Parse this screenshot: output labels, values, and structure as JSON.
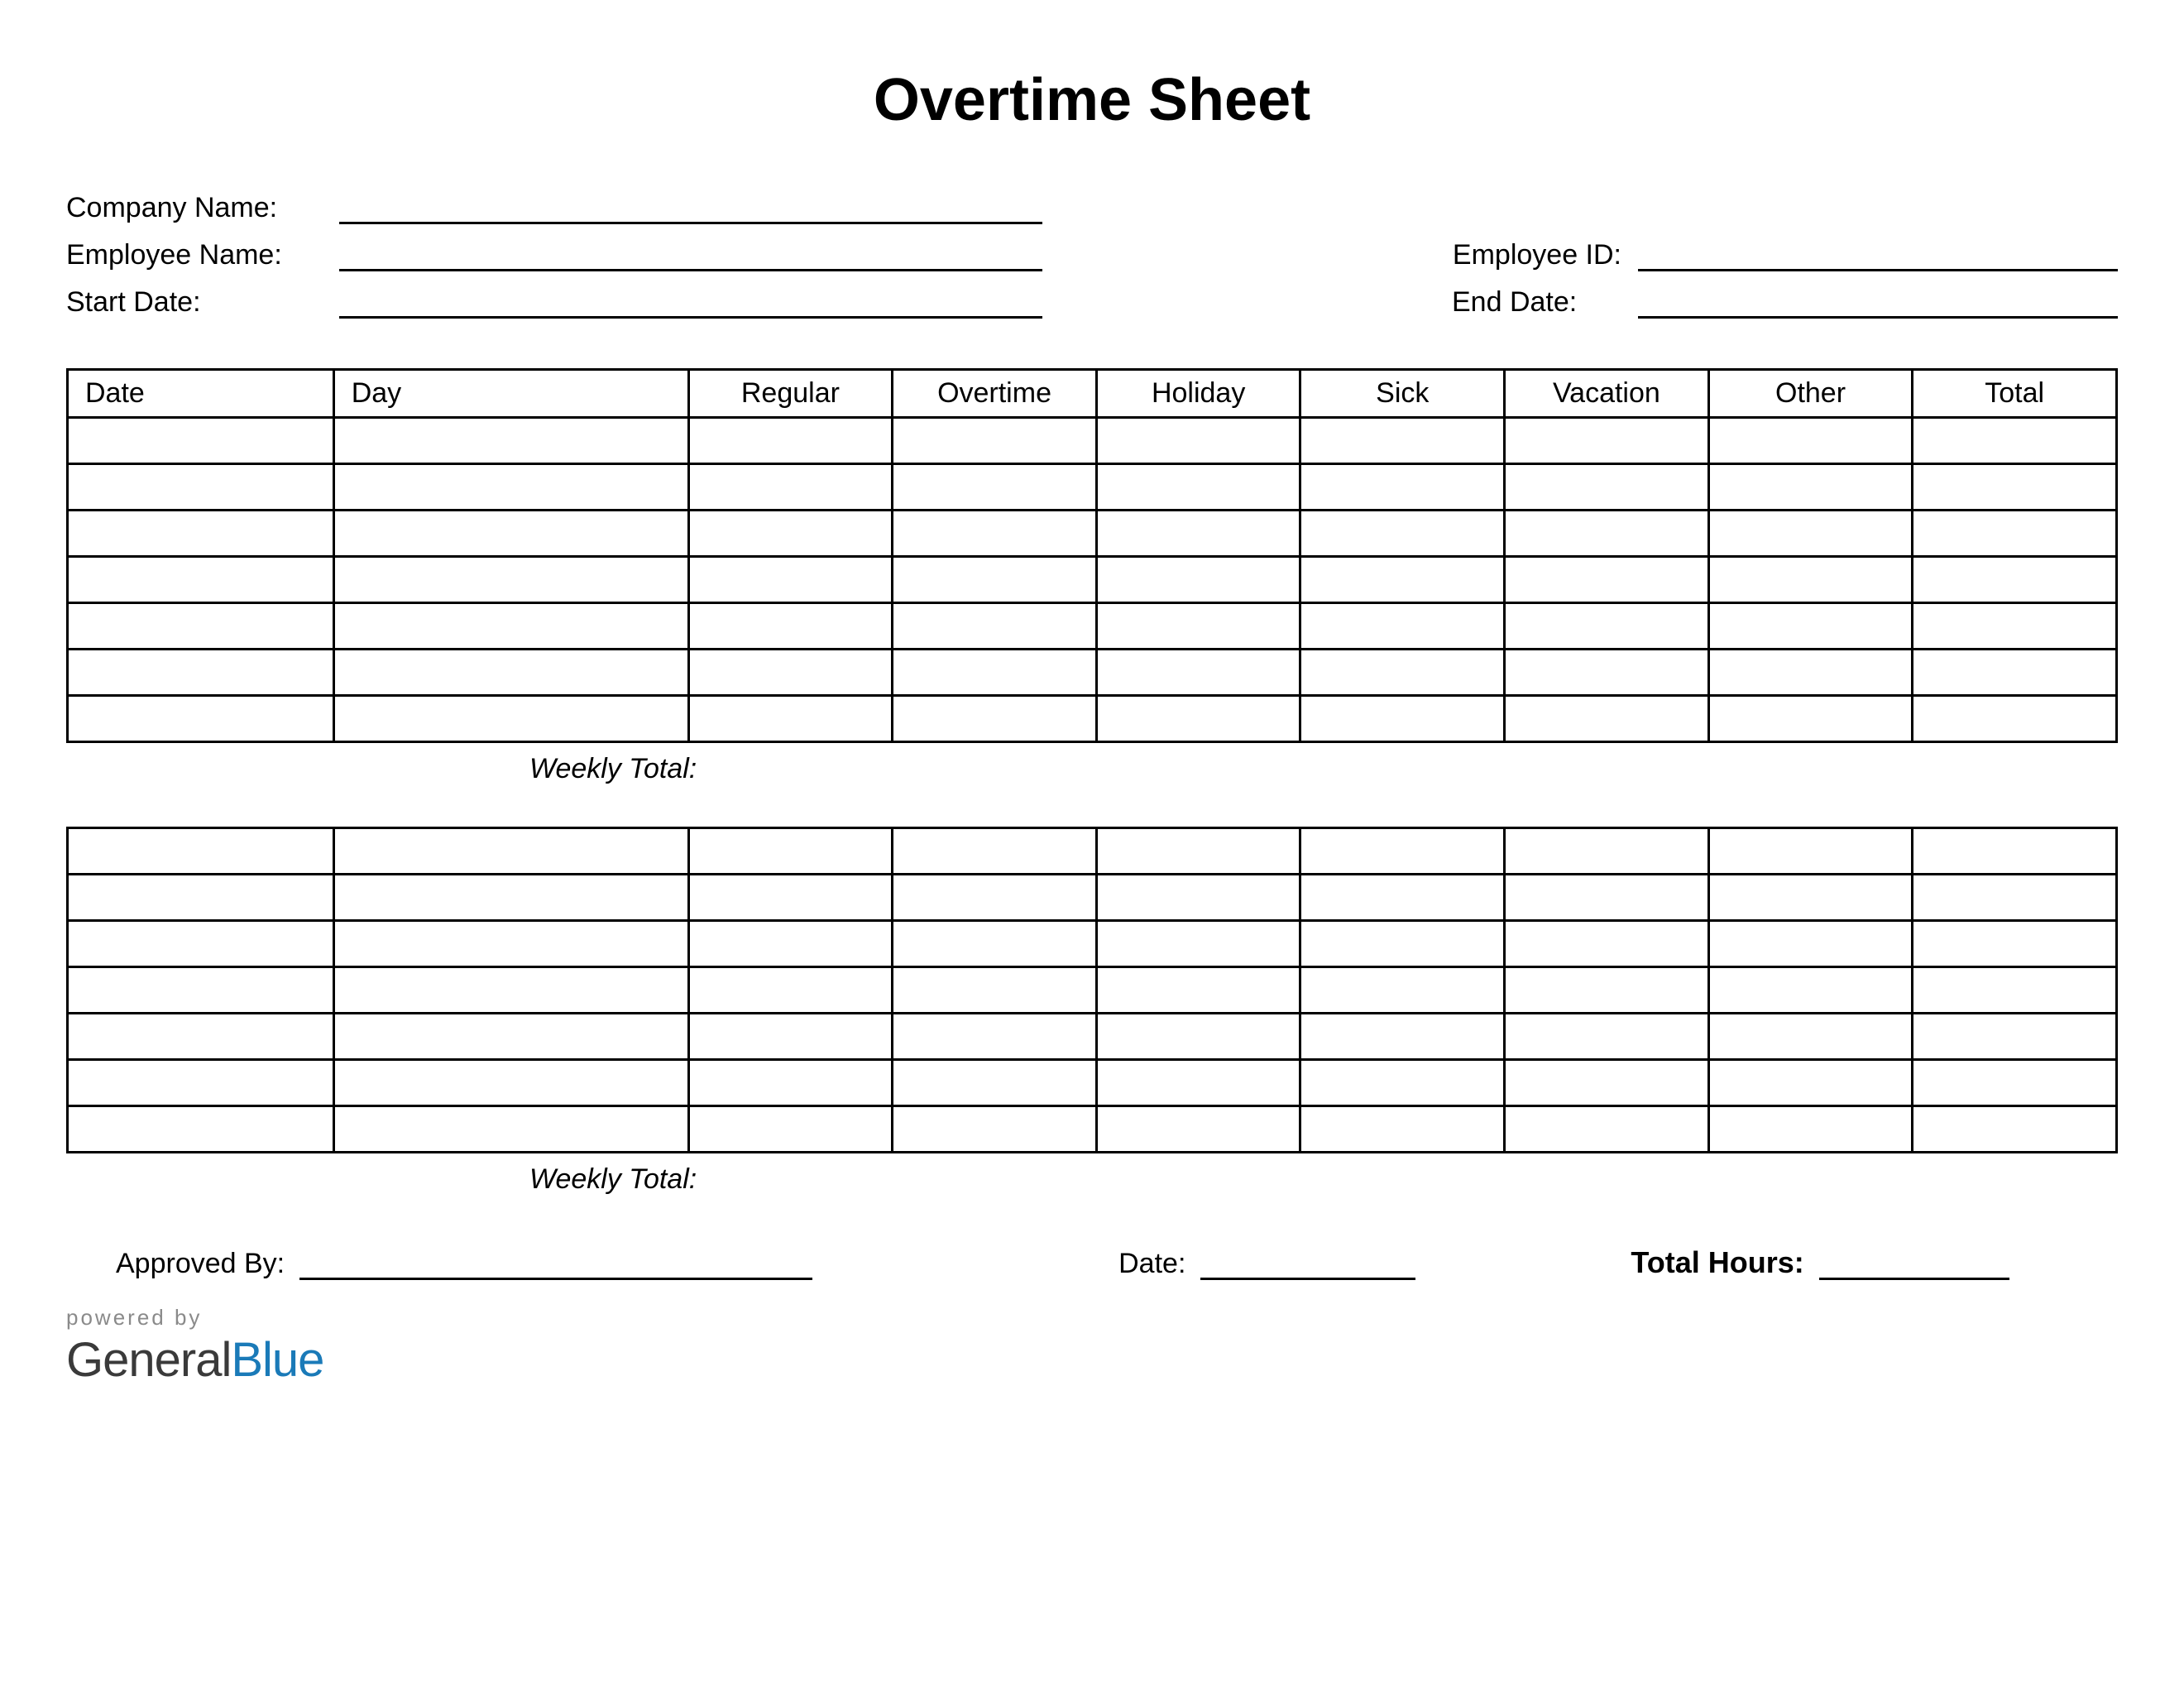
{
  "title": "Overtime Sheet",
  "header": {
    "company_name_label": "Company Name:",
    "employee_name_label": "Employee Name:",
    "employee_id_label": "Employee ID:",
    "start_date_label": "Start Date:",
    "end_date_label": "End Date:"
  },
  "table": {
    "columns": {
      "date": "Date",
      "day": "Day",
      "regular": "Regular",
      "overtime": "Overtime",
      "holiday": "Holiday",
      "sick": "Sick",
      "vacation": "Vacation",
      "other": "Other",
      "total": "Total"
    },
    "weekly_total_label": "Weekly Total:",
    "week1_rows": 7,
    "week2_rows": 7
  },
  "footer": {
    "approved_by_label": "Approved By:",
    "date_label": "Date:",
    "total_hours_label": "Total Hours:"
  },
  "logo": {
    "powered_by": "powered by",
    "brand_part1": "General",
    "brand_part2": "Blue"
  }
}
